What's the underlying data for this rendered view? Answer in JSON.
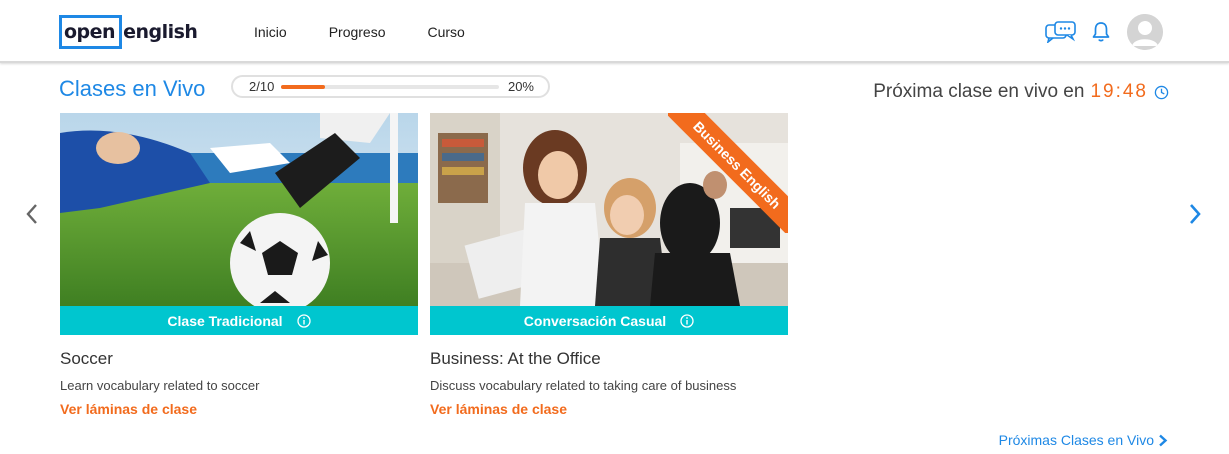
{
  "header": {
    "logo": {
      "part1": "open",
      "part2": "english"
    },
    "nav": [
      {
        "label": "Inicio"
      },
      {
        "label": "Progreso"
      },
      {
        "label": "Curso"
      }
    ],
    "icons": [
      "chat-icon",
      "bell-icon",
      "avatar"
    ]
  },
  "section": {
    "title": "Clases en Vivo",
    "progress": {
      "count": "2/10",
      "percent_label": "20%",
      "fraction": 0.2
    },
    "next_class_label": "Próxima clase en vivo en",
    "next_class_time": "19:48"
  },
  "cards": [
    {
      "image": "soccer-photo",
      "band_label": "Clase Tradicional",
      "title": "Soccer",
      "description": "Learn vocabulary related to soccer",
      "link": "Ver láminas de clase"
    },
    {
      "image": "office-photo",
      "ribbon": "Business English",
      "band_label": "Conversación Casual",
      "title": "Business: At the Office",
      "description": "Discuss vocabulary related to taking care of business",
      "link": "Ver láminas de clase"
    }
  ],
  "footer": {
    "more_link": "Próximas Clases en Vivo"
  },
  "colors": {
    "accent": "#1e88e5",
    "orange": "#f26b1d",
    "teal": "#00c6cf"
  }
}
